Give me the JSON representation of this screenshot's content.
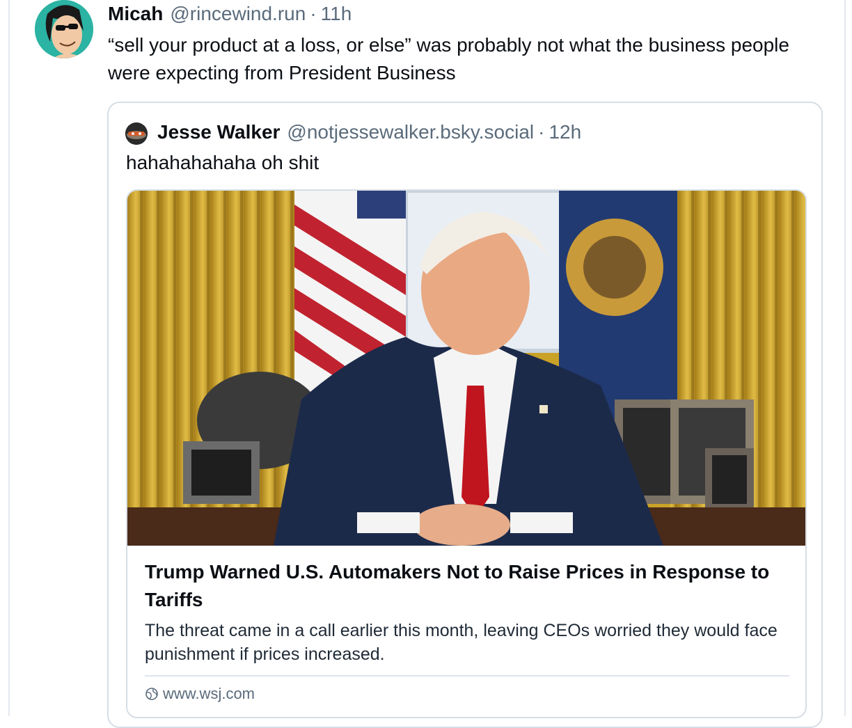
{
  "post": {
    "author_name": "Micah",
    "author_handle": "@rincewind.run",
    "separator": "·",
    "time": "11h",
    "text": "“sell your product at a loss, or else” was probably not what the business people were expecting from President Business"
  },
  "quote": {
    "author_name": "Jesse Walker",
    "author_handle": "@notjessewalker.bsky.social",
    "separator": "·",
    "time": "12h",
    "text": "hahahahahaha oh shit",
    "link": {
      "title": "Trump Warned U.S. Automakers Not to Raise Prices in Response to Tariffs",
      "description": "The threat came in a call earlier this month, leaving CEOs worried they would face punishment if prices increased.",
      "domain": "www.wsj.com",
      "icon": "globe-icon"
    }
  },
  "colors": {
    "text": "#0b0f14",
    "muted": "#5a6b7b",
    "border": "#d6dde5",
    "avatar_bg": "#2bb3a3",
    "curtain_gold": "#c9a227",
    "suit_navy": "#1c2a4a",
    "tie_red": "#c0151e"
  }
}
